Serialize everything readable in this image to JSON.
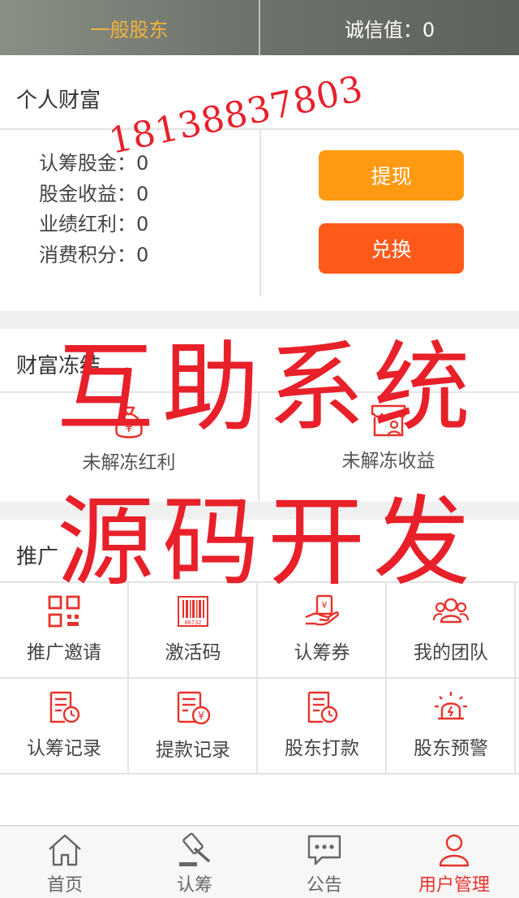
{
  "header": {
    "rank": "一般股东",
    "credit": "诚信值：0"
  },
  "wealth": {
    "title": "个人财富",
    "rows": [
      {
        "label": "认筹股金：0"
      },
      {
        "label": "股金收益：0"
      },
      {
        "label": "业绩红利：0"
      },
      {
        "label": "消费积分：0"
      }
    ],
    "withdraw_label": "提现",
    "exchange_label": "兑换"
  },
  "freeze": {
    "title": "财富冻结",
    "items": [
      {
        "label": "未解冻红利",
        "icon": "money-bag-icon"
      },
      {
        "label": "未解冻收益",
        "icon": "store-user-icon"
      }
    ]
  },
  "promotion": {
    "title": "推广",
    "items": [
      {
        "label": "推广邀请",
        "icon": "qr-code-icon"
      },
      {
        "label": "激活码",
        "icon": "barcode-icon",
        "barcode_text": "06732"
      },
      {
        "label": "认筹券",
        "icon": "hand-coupon-icon"
      },
      {
        "label": "我的团队",
        "icon": "team-icon"
      },
      {
        "label": "认筹记录",
        "icon": "record-clock-icon"
      },
      {
        "label": "提款记录",
        "icon": "record-yen-icon"
      },
      {
        "label": "股东打款",
        "icon": "record-clock-icon"
      },
      {
        "label": "股东预警",
        "icon": "alarm-icon"
      }
    ]
  },
  "tabbar": {
    "items": [
      {
        "label": "首页",
        "icon": "home-icon"
      },
      {
        "label": "认筹",
        "icon": "gavel-icon"
      },
      {
        "label": "公告",
        "icon": "message-icon"
      },
      {
        "label": "用户管理",
        "icon": "user-icon",
        "active": true
      }
    ]
  },
  "watermark": {
    "phone": "18138837803",
    "line1": "互助系统",
    "line2": "源码开发"
  },
  "colors": {
    "accent_red": "#e8322b",
    "withdraw_orange": "#ff9a12",
    "exchange_orange": "#ff5a1a",
    "rank_gold": "#f0b33a"
  }
}
